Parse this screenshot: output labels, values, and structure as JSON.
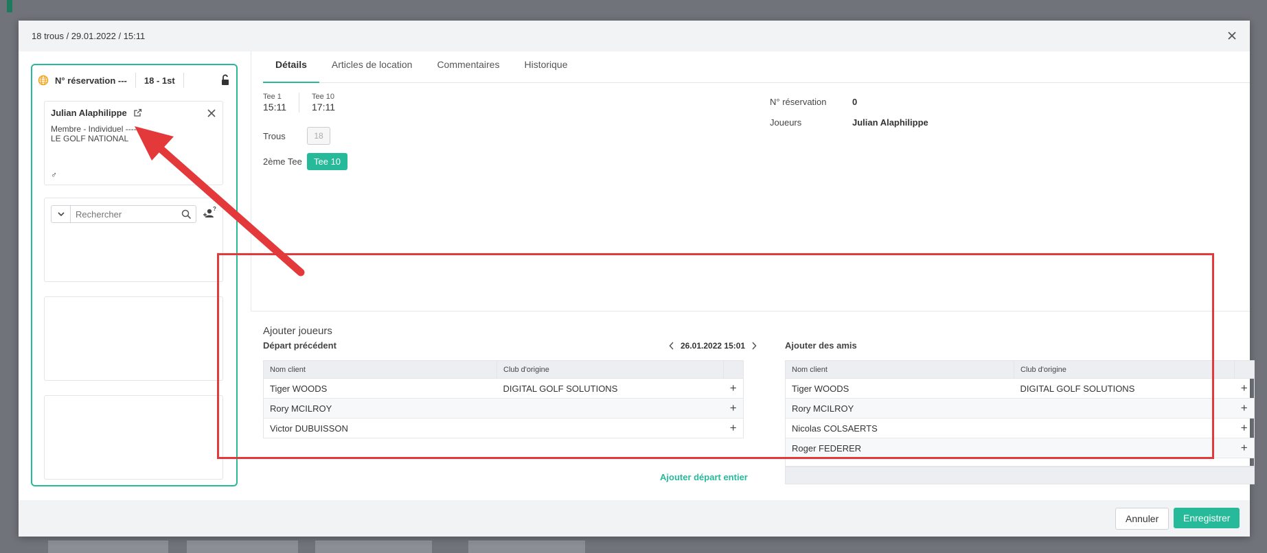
{
  "header": {
    "title": "18 trous / 29.01.2022 / 15:11"
  },
  "left": {
    "resa_label": "N° réservation ---",
    "hole_label": "18 - 1st",
    "player": {
      "name": "Julian Alaphilippe",
      "member_line1": "Membre - Individuel ------",
      "member_line2": "LE GOLF NATIONAL",
      "gender": "♂"
    },
    "search_placeholder": "Rechercher"
  },
  "tabs": [
    "Détails",
    "Articles de location",
    "Commentaires",
    "Historique"
  ],
  "details": {
    "tee1_label": "Tee 1",
    "tee1_time": "15:11",
    "tee10_label": "Tee 10",
    "tee10_time": "17:11",
    "trous_label": "Trous",
    "trous_value": "18",
    "second_tee_label": "2ème Tee",
    "second_tee_value": "Tee 10",
    "resa_key": "N° réservation",
    "resa_val": "0",
    "players_key": "Joueurs",
    "players_val": "Julian Alaphilippe"
  },
  "add_players": {
    "title": "Ajouter joueurs",
    "prev_departure": "Départ précédent",
    "date": "26.01.2022 15:01",
    "add_friends": "Ajouter des amis",
    "col_name": "Nom client",
    "col_club": "Club d'origine",
    "left_rows": [
      {
        "name": "Tiger WOODS",
        "club": "DIGITAL GOLF SOLUTIONS"
      },
      {
        "name": "Rory MCILROY",
        "club": ""
      },
      {
        "name": "Victor DUBUISSON",
        "club": ""
      }
    ],
    "right_rows": [
      {
        "name": "Tiger WOODS",
        "club": "DIGITAL GOLF SOLUTIONS"
      },
      {
        "name": "Rory MCILROY",
        "club": ""
      },
      {
        "name": "Nicolas COLSAERTS",
        "club": ""
      },
      {
        "name": "Roger FEDERER",
        "club": ""
      }
    ],
    "add_all": "Ajouter départ entier"
  },
  "footer": {
    "cancel": "Annuler",
    "save": "Enregistrer"
  },
  "colors": {
    "accent": "#26b99a",
    "highlight": "#e3393a"
  }
}
